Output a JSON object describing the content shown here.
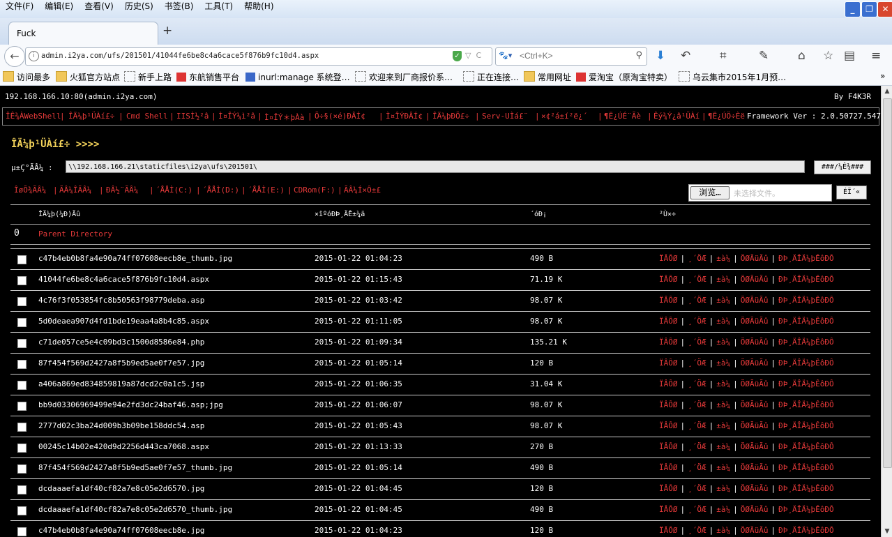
{
  "browser": {
    "menu": [
      "文件(F)",
      "编辑(E)",
      "查看(V)",
      "历史(S)",
      "书签(B)",
      "工具(T)",
      "帮助(H)"
    ],
    "tab_title": "Fuck",
    "new_tab": "+",
    "url": "admin.i2ya.com/ufs/201501/41044fe6be8c4a6cace5f876b9fc10d4.aspx",
    "search_engine": "百度",
    "search_placeholder": "<Ctrl+K>",
    "bookmarks": [
      "访问最多",
      "火狐官方站点",
      "新手上路",
      "东航销售平台",
      "inurl:manage 系统登…",
      "欢迎来到厂商报价系…",
      "正在连接…",
      "常用网址",
      "爱淘宝（原淘宝特卖）",
      "乌云集市2015年1月预…"
    ]
  },
  "shell": {
    "host": "192.168.166.10:80(admin.i2ya.com)",
    "author": "By F4K3R",
    "nav": [
      "ÎÊ¾ÀWebShell",
      "ÎÄ¼þ¹ÜÀí£÷",
      "Cmd Shell",
      "IISÌ½²â",
      "Ì¤ÎÝ¼ì²â",
      "Ì¤ÎÝ＊þÀà",
      "Õ÷§(×é)ÐÂÍ¢",
      "Ì¤ÎÝÐÂÍ¢",
      "ÎÄ¼þÐÕ£÷",
      "Serv-UÌá£¨",
      "×¢²á±í²ë¿´",
      "¶Ë¿ÚÉ¨Ãè",
      "Êý¾Ý¿â¹ÜÀí",
      "¶Ë¿ÚÖ÷Èë"
    ],
    "framework": "Framework Ver : 2.0.50727.5472",
    "title": "ÎÄ¼þ¹ÜÀí£÷ >>>>",
    "path_label": "µ±Ç°ÃÂ¼ :",
    "path_value": "\\\\192.168.166.21\\staticfiles\\i2ya\\ufs\\201501\\",
    "go_label": "###/¼Ê¾###",
    "drives": [
      "ÎøÕ¾ÃÂ¼",
      "ÃÂ¼ÎÃÂ¼",
      "ÐÂ½¨ÃÂ¼",
      "´ÅÅÌ(C:)",
      "´ÅÅÌ(D:)",
      "´ÅÅÌ(E:)",
      "CDRom(F:)",
      "ÃÂ¼Í×Ô±£"
    ],
    "browse_label": "浏览…",
    "no_file": "未选择文件。",
    "upload_label": "ÉÏ´«",
    "columns": [
      "ÎÄ¼þ(¼Ð)Ãû",
      "×îºóÐÞ¸ÄÊ±¼ä",
      "´óÐ¡",
      "²Ù×÷"
    ],
    "parent_dir": "Parent Directory",
    "actions": [
      "ÏÂÔØ",
      "¸´ÖÆ",
      "±à¼",
      "ÖØÃüÃû",
      "ÐÞ¸ÄÎÄ¼þÊôÐÔ"
    ],
    "files": [
      {
        "name": "c47b4eb0b8fa4e90a74ff07608eecb8e_thumb.jpg",
        "date": "2015-01-22 01:04:23",
        "size": "490 B"
      },
      {
        "name": "41044fe6be8c4a6cace5f876b9fc10d4.aspx",
        "date": "2015-01-22 01:15:43",
        "size": "71.19 K"
      },
      {
        "name": "4c76f3f053854fc8b50563f98779deba.asp",
        "date": "2015-01-22 01:03:42",
        "size": "98.07 K"
      },
      {
        "name": "5d0deaea907d4fd1bde19eaa4a8b4c85.aspx",
        "date": "2015-01-22 01:11:05",
        "size": "98.07 K"
      },
      {
        "name": "c71de057ce5e4c09bd3c1500d8586e84.php",
        "date": "2015-01-22 01:09:34",
        "size": "135.21 K"
      },
      {
        "name": "87f454f569d2427a8f5b9ed5ae0f7e57.jpg",
        "date": "2015-01-22 01:05:14",
        "size": "120 B"
      },
      {
        "name": "a406a869ed834859819a87dcd2c0a1c5.jsp",
        "date": "2015-01-22 01:06:35",
        "size": "31.04 K"
      },
      {
        "name": "bb9d03306969499e94e2fd3dc24baf46.asp;jpg",
        "date": "2015-01-22 01:06:07",
        "size": "98.07 K"
      },
      {
        "name": "2777d02c3ba24d009b3b09be158ddc54.asp",
        "date": "2015-01-22 01:05:43",
        "size": "98.07 K"
      },
      {
        "name": "00245c14b02e420d9d2256d443ca7068.aspx",
        "date": "2015-01-22 01:13:33",
        "size": "270 B"
      },
      {
        "name": "87f454f569d2427a8f5b9ed5ae0f7e57_thumb.jpg",
        "date": "2015-01-22 01:05:14",
        "size": "490 B"
      },
      {
        "name": "dcdaaaefa1df40cf82a7e8c05e2d6570.jpg",
        "date": "2015-01-22 01:04:45",
        "size": "120 B"
      },
      {
        "name": "dcdaaaefa1df40cf82a7e8c05e2d6570_thumb.jpg",
        "date": "2015-01-22 01:04:45",
        "size": "490 B"
      },
      {
        "name": "c47b4eb0b8fa4e90a74ff07608eecb8e.jpg",
        "date": "2015-01-22 01:04:23",
        "size": "120 B"
      }
    ]
  }
}
